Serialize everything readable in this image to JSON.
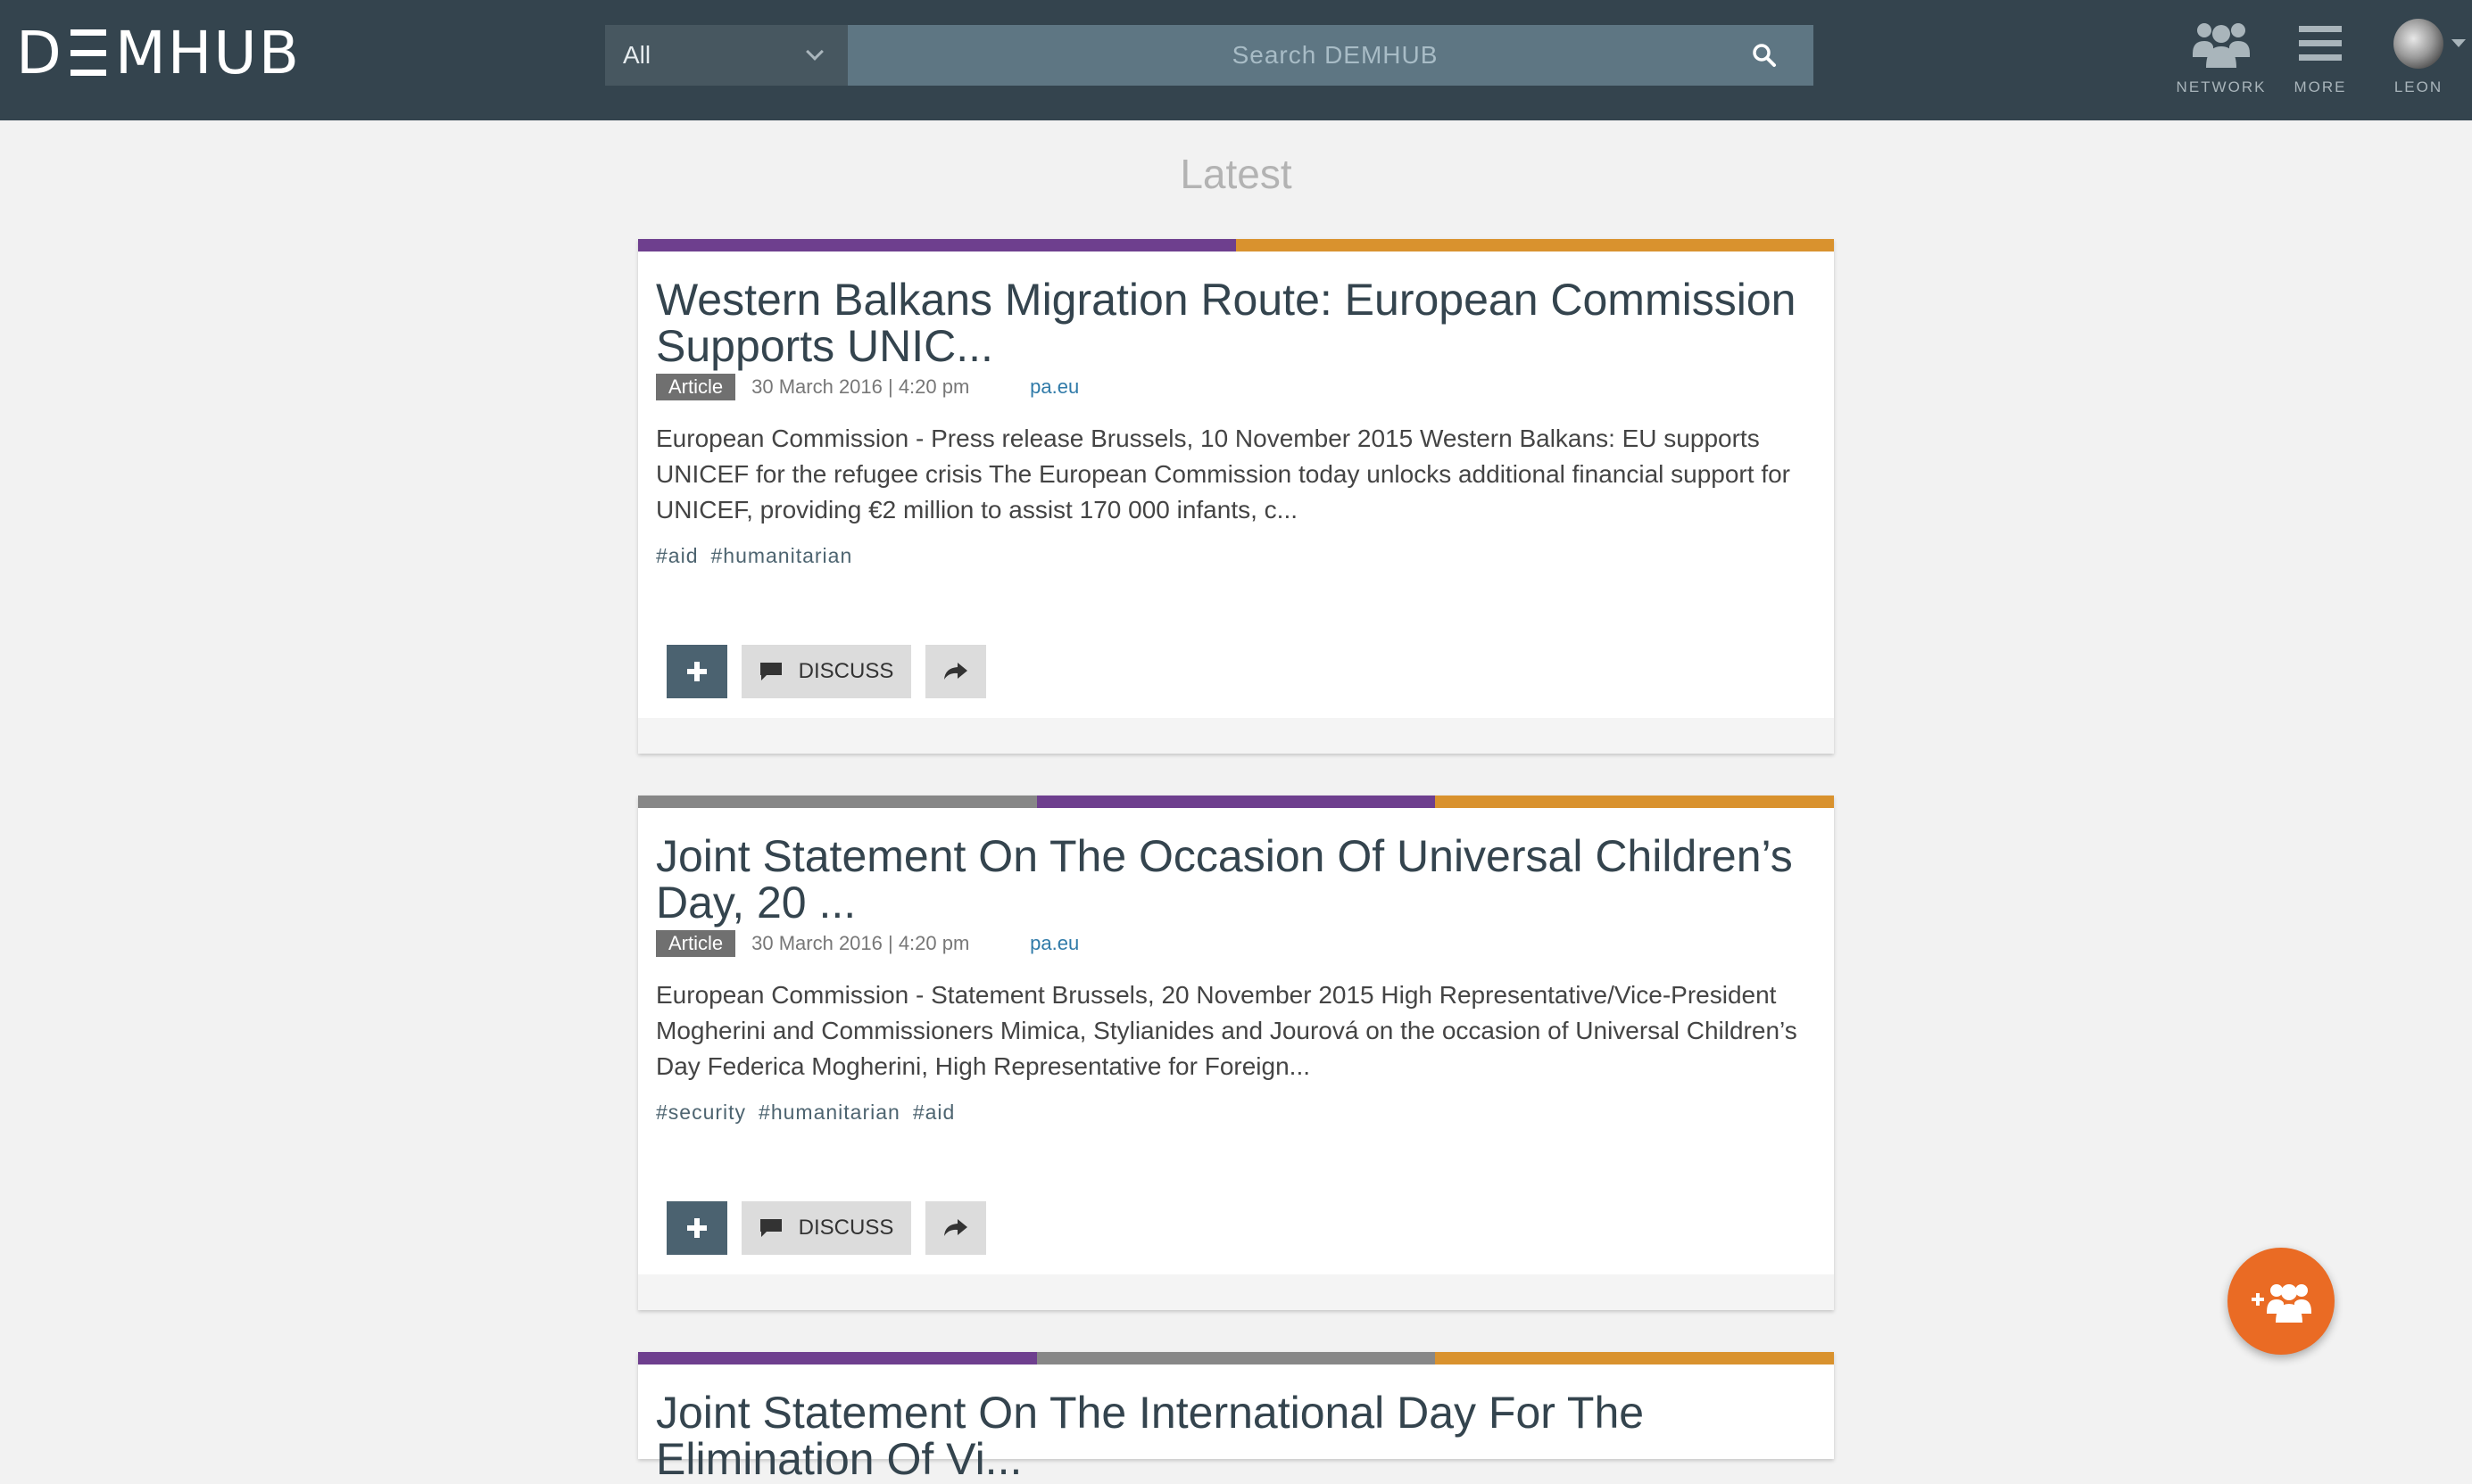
{
  "header": {
    "logo_text": "MHUB",
    "scope": "All",
    "search_placeholder": "Search DEMHUB",
    "nav": [
      {
        "label": "NETWORK",
        "icon": "network-icon"
      },
      {
        "label": "MORE",
        "icon": "menu-icon"
      },
      {
        "label": "LEON",
        "icon": "avatar"
      }
    ]
  },
  "main": {
    "section_title": "Latest",
    "posts": [
      {
        "title": "Western Balkans Migration Route: European Commission Supports UNIC...",
        "type": "Article",
        "date": "30 March 2016 | 4:20 pm",
        "source": "pa.eu",
        "excerpt": "European Commission - Press release Brussels, 10 November 2015 Western Balkans: EU supports UNICEF for the refugee crisis The European Commission today unlocks additional financial support for UNICEF, providing €2 million to assist 170 000 infants, c...",
        "tags": [
          "#aid",
          "#humanitarian"
        ],
        "bar_colors": [
          "#6e3f8e",
          "#d9922e"
        ],
        "discuss_label": "DISCUSS"
      },
      {
        "title": "Joint Statement On The Occasion Of Universal Children’s Day, 20 ...",
        "type": "Article",
        "date": "30 March 2016 | 4:20 pm",
        "source": "pa.eu",
        "excerpt": "European Commission - Statement Brussels, 20 November 2015 High Representative/Vice-President Mogherini and Commissioners Mimica, Stylianides and Jourová on the occasion of Universal Children’s Day Federica Mogherini, High Representative for Foreign...",
        "tags": [
          "#security",
          "#humanitarian",
          "#aid"
        ],
        "bar_colors": [
          "#878787",
          "#6e3f8e",
          "#d9922e"
        ],
        "discuss_label": "DISCUSS"
      },
      {
        "title": "Joint Statement On The International Day For The Elimination Of Vi...",
        "bar_colors": [
          "#6e3f8e",
          "#878787",
          "#d9922e"
        ]
      }
    ]
  },
  "fab": {
    "icon": "add-group-icon"
  },
  "colors": {
    "topbar": "#34444e",
    "accent_orange": "#ea6b24",
    "purple": "#6e3f8e",
    "gold": "#d9922e",
    "grey": "#878787"
  }
}
